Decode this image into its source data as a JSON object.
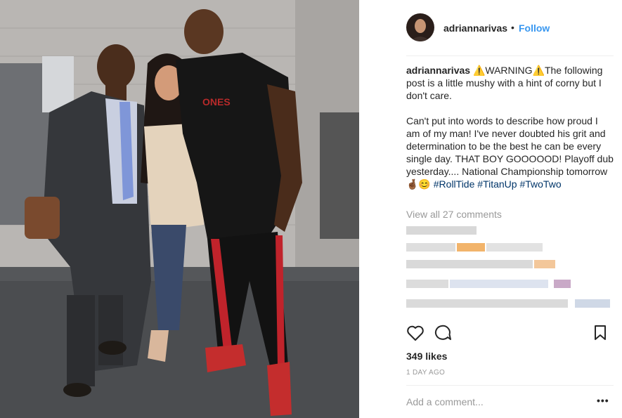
{
  "post": {
    "username": "adriannarivas",
    "separator": "•",
    "follow_label": "Follow"
  },
  "caption": {
    "username": "adriannarivas",
    "line1": "⚠️WARNING⚠️The following post is a little mushy with a hint of corny but I don't care.",
    "line2": "Can't put into words to describe how proud I am of my man! I've never doubted his grit and determination to be the best he can be every single day. THAT BOY GOOOOOD! Playoff dub yesterday.... National Championship tomorrow 🤞🏾😊",
    "tags": [
      "#RollTide",
      "#TitanUp",
      "#TwoTwo"
    ]
  },
  "comments": {
    "view_all": "View all 27 comments"
  },
  "actions": {
    "icons": [
      "heart-icon",
      "comment-icon",
      "bookmark-icon"
    ]
  },
  "stats": {
    "likes": "349 likes",
    "time": "1 DAY AGO"
  },
  "composer": {
    "placeholder": "Add a comment...",
    "more": "•••"
  },
  "colors": {
    "link": "#3897f0",
    "hashtag": "#003569",
    "muted": "#999999",
    "text": "#262626"
  }
}
